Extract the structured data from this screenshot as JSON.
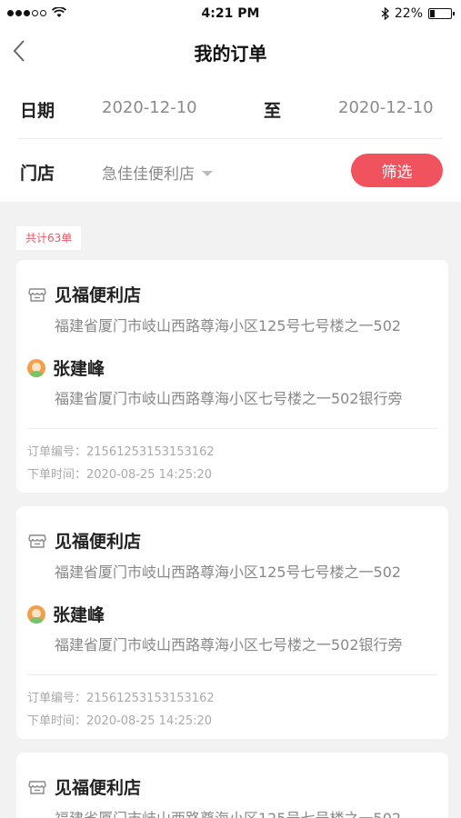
{
  "status_bar": {
    "time": "4:21 PM",
    "battery": "22%",
    "battery_level": 0.22
  },
  "nav": {
    "title": "我的订单"
  },
  "filter": {
    "date_label": "日期",
    "start_date": "2020-12-10",
    "to_label": "至",
    "end_date": "2020-12-10",
    "store_label": "门店",
    "store_value": "急佳佳便利店",
    "filter_button": "筛选"
  },
  "summary": {
    "count_text": "共计63单"
  },
  "orders": [
    {
      "store_name": "见福便利店",
      "store_address": "福建省厦门市岐山西路尊海小区125号七号楼之一502",
      "customer_name": "张建峰",
      "customer_address": "福建省厦门市岐山西路尊海小区七号楼之一502银行旁",
      "order_no": "订单编号：21561253153153162",
      "order_time": "下单时间：2020-08-25 14:25:20"
    },
    {
      "store_name": "见福便利店",
      "store_address": "福建省厦门市岐山西路尊海小区125号七号楼之一502",
      "customer_name": "张建峰",
      "customer_address": "福建省厦门市岐山西路尊海小区七号楼之一502银行旁",
      "order_no": "订单编号：21561253153153162",
      "order_time": "下单时间：2020-08-25 14:25:20"
    },
    {
      "store_name": "见福便利店",
      "store_address": "福建省厦门市岐山西路尊海小区125号七号楼之一502"
    }
  ]
}
